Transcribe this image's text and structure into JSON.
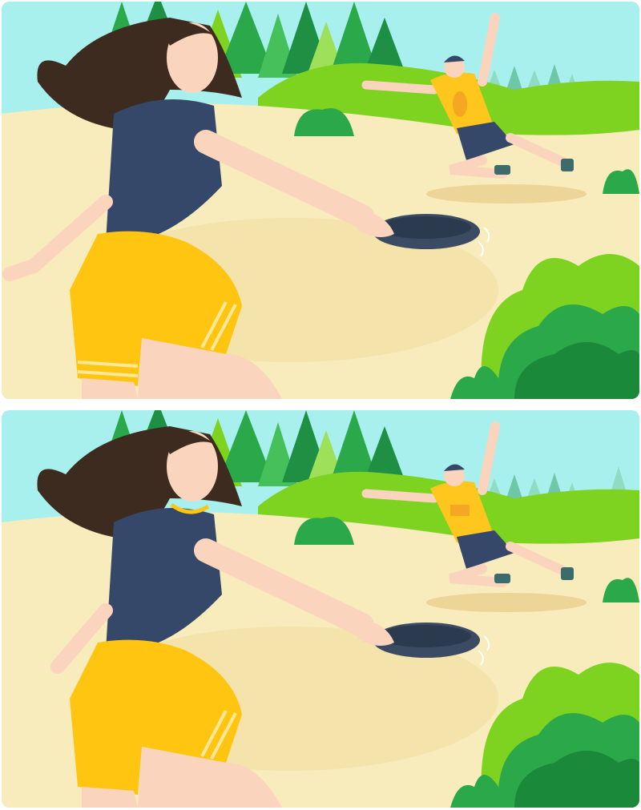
{
  "game": {
    "type": "spot-the-difference",
    "panels": [
      {
        "id": "original",
        "position": "top"
      },
      {
        "id": "modified",
        "position": "bottom"
      }
    ]
  },
  "colors": {
    "sky": "#a8f0ee",
    "sand": "#f8ebbc",
    "sand_shadow": "#f2dfa3",
    "grass_light": "#7ed321",
    "grass_dark": "#1a8a3a",
    "tree_green": "#2aa84a",
    "hair": "#3d2b1f",
    "shirt_navy": "#354869",
    "shorts_yellow": "#ffc511",
    "skin": "#fad4bc",
    "man_shirt": "#ffc61e",
    "frisbee": "#3b4b63"
  }
}
